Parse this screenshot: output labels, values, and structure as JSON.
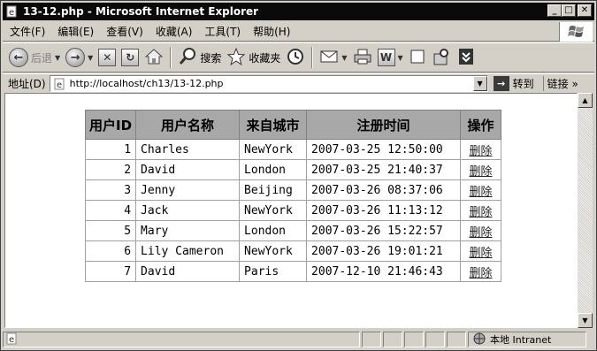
{
  "window": {
    "title": "13-12.php - Microsoft Internet Explorer"
  },
  "menu": [
    "文件(F)",
    "编辑(E)",
    "查看(V)",
    "收藏(A)",
    "工具(T)",
    "帮助(H)"
  ],
  "toolbar": {
    "back": "后退",
    "search": "搜索",
    "favorites": "收藏夹"
  },
  "address": {
    "label": "地址(D)",
    "url": "http://localhost/ch13/13-12.php",
    "go": "转到",
    "links": "链接"
  },
  "table": {
    "headers": [
      "用户ID",
      "用户名称",
      "来自城市",
      "注册时间",
      "操作"
    ],
    "rows": [
      {
        "id": "1",
        "name": "Charles",
        "city": "NewYork",
        "time": "2007-03-25 12:50:00",
        "op": "删除"
      },
      {
        "id": "2",
        "name": "David",
        "city": "London",
        "time": "2007-03-25 21:40:37",
        "op": "删除"
      },
      {
        "id": "3",
        "name": "Jenny",
        "city": "Beijing",
        "time": "2007-03-26 08:37:06",
        "op": "删除"
      },
      {
        "id": "4",
        "name": "Jack",
        "city": "NewYork",
        "time": "2007-03-26 11:13:12",
        "op": "删除"
      },
      {
        "id": "5",
        "name": "Mary",
        "city": "London",
        "time": "2007-03-26 15:22:57",
        "op": "删除"
      },
      {
        "id": "6",
        "name": "Lily Cameron",
        "city": "NewYork",
        "time": "2007-03-26 19:01:21",
        "op": "删除"
      },
      {
        "id": "7",
        "name": "David",
        "city": "Paris",
        "time": "2007-12-10 21:46:43",
        "op": "删除"
      }
    ]
  },
  "status": {
    "zone": "本地 Intranet"
  }
}
